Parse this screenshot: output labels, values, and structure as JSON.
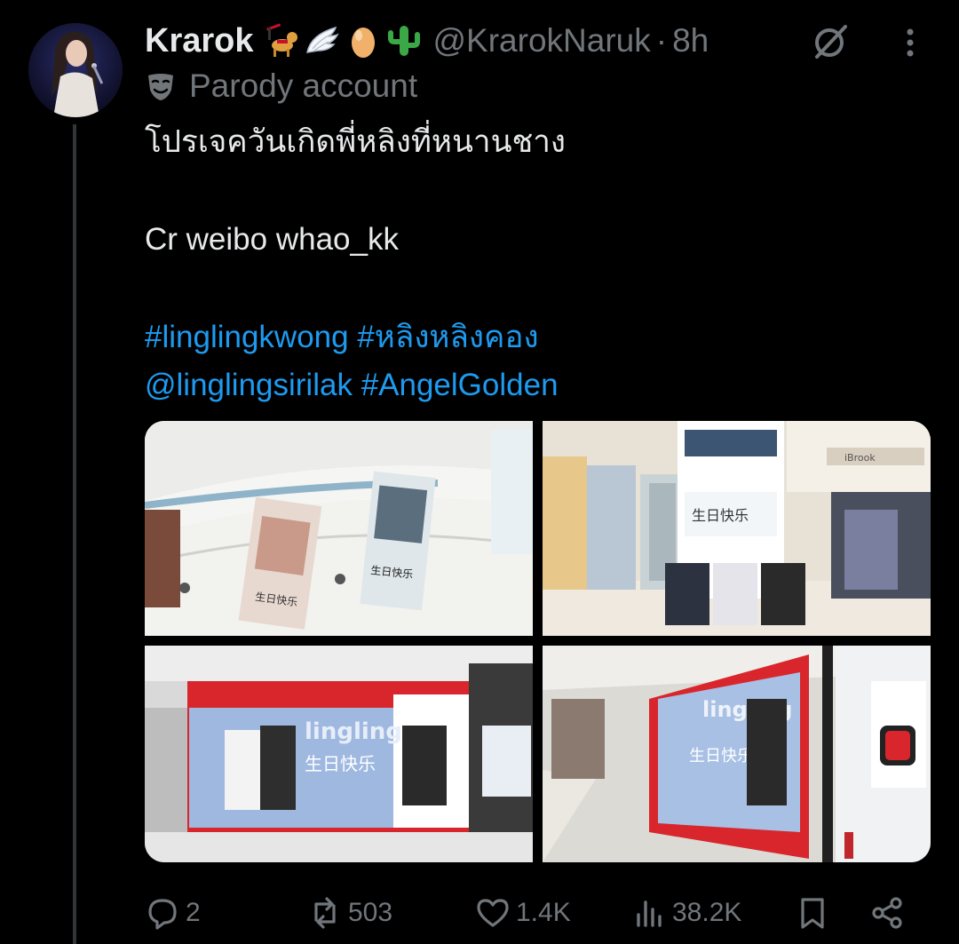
{
  "post": {
    "display_name": "Krarok",
    "emojis": [
      "guide-dog-icon",
      "wing-icon",
      "egg-icon",
      "cactus-icon"
    ],
    "handle": "@KrarokNaruk",
    "separator": "·",
    "time": "8h",
    "label": "Parody account",
    "text_line1": "โปรเจควันเกิดพี่หลิงที่หนานชาง",
    "text_line2": "Cr weibo whao_kk",
    "tag1": "#linglingkwong",
    "tag2": "#หลิงหลิงคอง",
    "mention": "@linglingsirilak",
    "tag3": "#AngelGolden"
  },
  "photos": [
    {
      "name": "photo-mall-atrium-banners",
      "texts": [
        "生日快乐",
        "生日快乐"
      ]
    },
    {
      "name": "photo-mall-corridor-standees",
      "texts": [
        "生日快乐",
        "iBrook"
      ]
    },
    {
      "name": "photo-store-wall-mural-front",
      "texts": [
        "lingling",
        "生日快乐"
      ]
    },
    {
      "name": "photo-store-wall-mural-side",
      "texts": [
        "lingling",
        "生日快乐"
      ]
    }
  ],
  "actions": {
    "replies": "2",
    "reposts": "503",
    "likes": "1.4K",
    "views": "38.2K"
  },
  "colors": {
    "background": "#000000",
    "text": "#e7e9ea",
    "secondary": "#71767b",
    "link": "#1d9bf0",
    "thread_line": "#333639"
  }
}
